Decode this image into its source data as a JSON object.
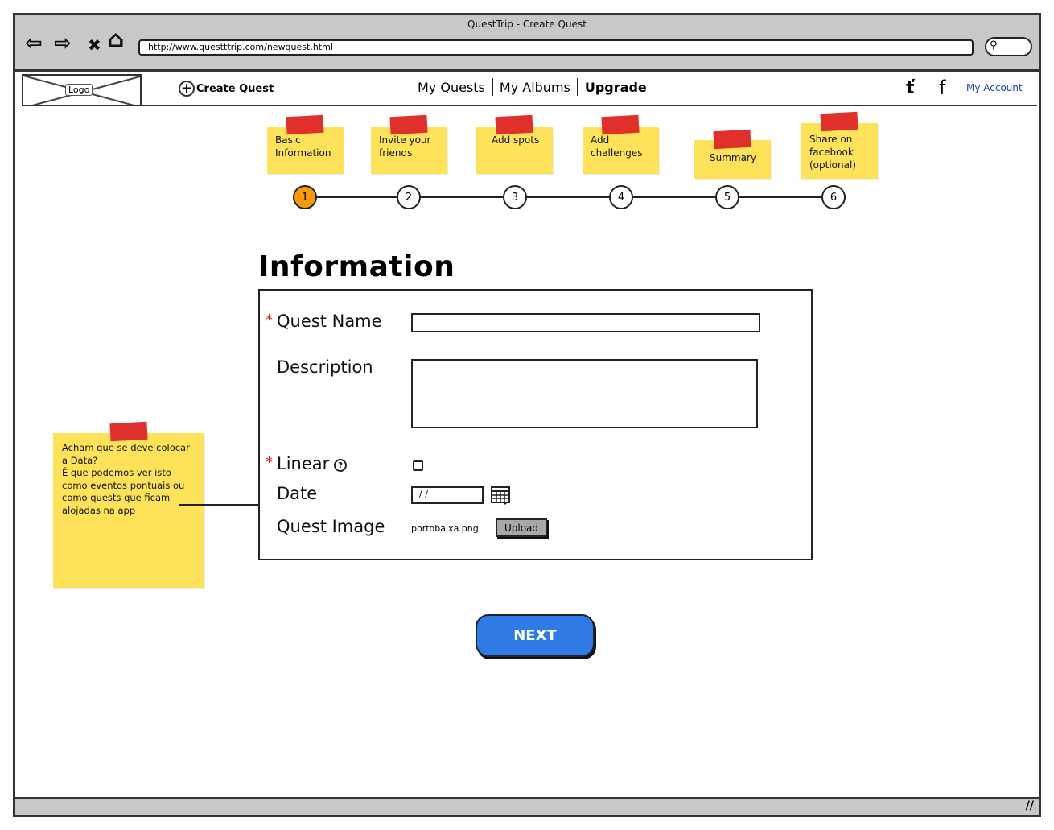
{
  "window": {
    "title": "QuestTrip - Create Quest"
  },
  "browser": {
    "url": "http://www.questttrip.com/newquest.html",
    "back_glyph": "⇦",
    "forward_glyph": "⇨",
    "stop_glyph": "✖",
    "home_glyph": "⌂",
    "search_glyph": "🔍︎"
  },
  "header": {
    "logo_label": "Logo",
    "create_quest_label": "Create Quest",
    "nav": [
      {
        "label": "My Quests"
      },
      {
        "label": "My Albums"
      },
      {
        "label": "Upgrade"
      }
    ],
    "twitter_glyph": "ť",
    "facebook_glyph": "f",
    "account_label": "My Account",
    "account_color": "#1a3fa8"
  },
  "wizard": {
    "steps": [
      {
        "number": "1",
        "note": "Basic\nInformation",
        "active": true
      },
      {
        "number": "2",
        "note": "Invite your\nfriends",
        "active": false
      },
      {
        "number": "3",
        "note": "Add spots",
        "active": false
      },
      {
        "number": "4",
        "note": "Add\nchallenges",
        "active": false
      },
      {
        "number": "5",
        "note": "Summary",
        "active": false
      },
      {
        "number": "6",
        "note": "Share on\nfacebook\n(optional)",
        "active": false
      }
    ],
    "active_color": "#f59a0c"
  },
  "form": {
    "title": "Information",
    "required_marker": "*",
    "quest_name_label": "Quest Name",
    "quest_name_value": "",
    "description_label": "Description",
    "description_value": "",
    "linear_label": "Linear",
    "linear_help_glyph": "?",
    "linear_checked": false,
    "date_label": "Date",
    "date_value": " / /",
    "quest_image_label": "Quest Image",
    "quest_image_file": "portobaixa.png",
    "upload_label": "Upload"
  },
  "annotation": {
    "text": "Acham que se deve colocar a Data?\nÉ que podemos ver isto como eventos pontuais ou como quests que ficam alojadas na app"
  },
  "next_label": "NEXT",
  "colors": {
    "sticky": "#fde25a",
    "tape": "#e0302b",
    "primary_button": "#2f7ae5",
    "required": "#d32020"
  }
}
